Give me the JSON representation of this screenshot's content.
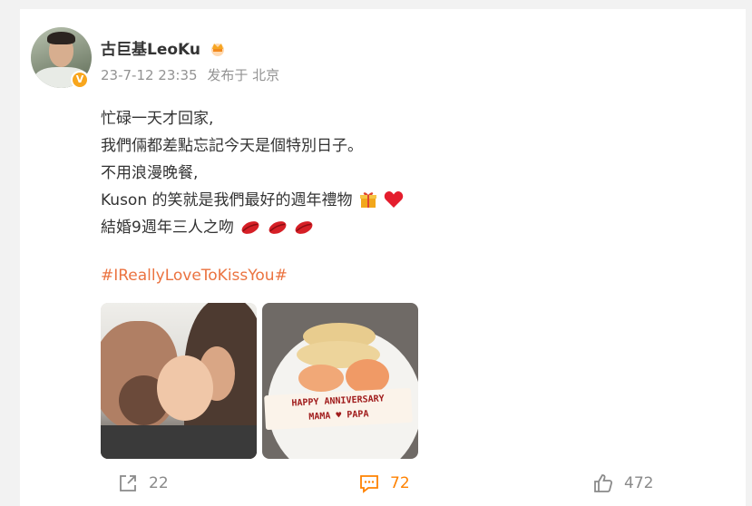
{
  "user": {
    "name": "古巨基LeoKu",
    "verified_badge": "V",
    "crown_icon": "crown-icon"
  },
  "meta": {
    "time": "23-7-12 23:35",
    "location": "发布于 北京"
  },
  "post": {
    "lines": [
      "忙碌一天才回家,",
      "我們倆都差點忘記今天是個特別日子。",
      "不用浪漫晚餐,",
      "Kuson 的笑就是我們最好的週年禮物",
      "結婚9週年三人之吻"
    ],
    "hashtag": "#IReallyLoveToKissYou#"
  },
  "photos": {
    "sign_line1": "HAPPY ANNIVERSARY",
    "sign_line2": "MAMA ♥ PAPA"
  },
  "actions": {
    "repost_count": "22",
    "comment_count": "72",
    "like_count": "472",
    "comment_color": "#ff8200"
  },
  "colors": {
    "hashtag": "#eb7340",
    "meta": "#939393"
  }
}
